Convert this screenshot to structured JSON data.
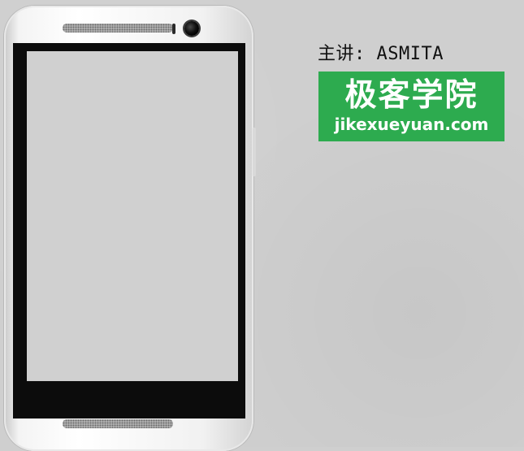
{
  "lecturer": {
    "label": "主讲: ASMITA"
  },
  "logo": {
    "chinese": "极客学院",
    "domain": "jikexueyuan.com",
    "bg_color": "#2dab4f"
  },
  "phone": {
    "screen_color": "#d0d0d0",
    "body_color": "#f2f2f2"
  },
  "background_color": "#cfcfcf"
}
